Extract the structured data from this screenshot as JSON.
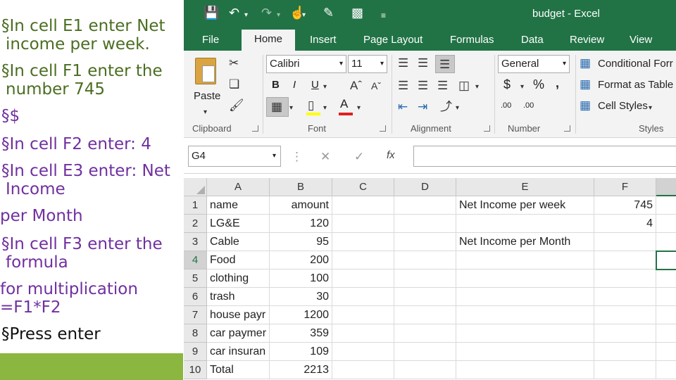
{
  "slide": {
    "lines": [
      {
        "text": "§In cell E1 enter Net",
        "color": "green"
      },
      {
        "text": "income per week.",
        "color": "green"
      },
      {
        "text": "§In cell F1 enter the",
        "color": "green"
      },
      {
        "text": "number 745",
        "color": "green"
      },
      {
        "text": "§$",
        "color": "purple"
      },
      {
        "text": "§In cell F2 enter:  4",
        "color": "purple"
      },
      {
        "text": "§In cell E3 enter: Net",
        "color": "purple"
      },
      {
        "text": "Income",
        "color": "purple"
      },
      {
        "text": "per Month",
        "color": "purple"
      },
      {
        "text": "§In cell F3 enter the",
        "color": "purple"
      },
      {
        "text": "formula",
        "color": "purple"
      },
      {
        "text": "for multiplication",
        "color": "purple"
      },
      {
        "text": "=F1*F2",
        "color": "purple"
      },
      {
        "text": "§Press enter",
        "color": "black"
      }
    ]
  },
  "excel": {
    "title": "budget - Excel",
    "tabs": [
      "File",
      "Home",
      "Insert",
      "Page Layout",
      "Formulas",
      "Data",
      "Review",
      "View"
    ],
    "active_tab": "Home",
    "ribbon": {
      "paste_label": "Paste",
      "clipboard_label": "Clipboard",
      "font_name": "Calibri",
      "font_size": "11",
      "font_label": "Font",
      "alignment_label": "Alignment",
      "number_format": "General",
      "number_label": "Number",
      "conditional_formatting": "Conditional Forr",
      "format_as_table": "Format as Table",
      "cell_styles": "Cell Styles",
      "styles_label": "Styles",
      "bold": "B",
      "italic": "I",
      "underline": "U",
      "currency": "$",
      "percent": "%",
      "comma": ",",
      "inc_decimal": ".00",
      "dec_decimal": ".00"
    },
    "name_box": "G4",
    "formula_value": "",
    "fx_label": "fx",
    "columns": [
      "A",
      "B",
      "C",
      "D",
      "E",
      "F"
    ],
    "selected_row": "4",
    "rows": [
      {
        "num": "1",
        "A": "name",
        "B": "amount",
        "E": "Net Income per week",
        "F": "745"
      },
      {
        "num": "2",
        "A": "LG&E",
        "B": "120",
        "E": "",
        "F": "4"
      },
      {
        "num": "3",
        "A": "Cable",
        "B": "95",
        "E": "Net Income per Month",
        "F": ""
      },
      {
        "num": "4",
        "A": "Food",
        "B": "200",
        "E": "",
        "F": ""
      },
      {
        "num": "5",
        "A": "clothing",
        "B": "100",
        "E": "",
        "F": ""
      },
      {
        "num": "6",
        "A": "trash",
        "B": "30",
        "E": "",
        "F": ""
      },
      {
        "num": "7",
        "A": "house payr",
        "B": "1200",
        "E": "",
        "F": ""
      },
      {
        "num": "8",
        "A": "car paymer",
        "B": "359",
        "E": "",
        "F": ""
      },
      {
        "num": "9",
        "A": "car insuran",
        "B": "109",
        "E": "",
        "F": ""
      },
      {
        "num": "10",
        "A": "Total",
        "B": "2213",
        "E": "",
        "F": ""
      }
    ],
    "colors": {
      "excel_green": "#217346",
      "slide_green": "#4b6e22",
      "slide_purple": "#7030a0",
      "accent_bar": "#8bb63f"
    }
  }
}
